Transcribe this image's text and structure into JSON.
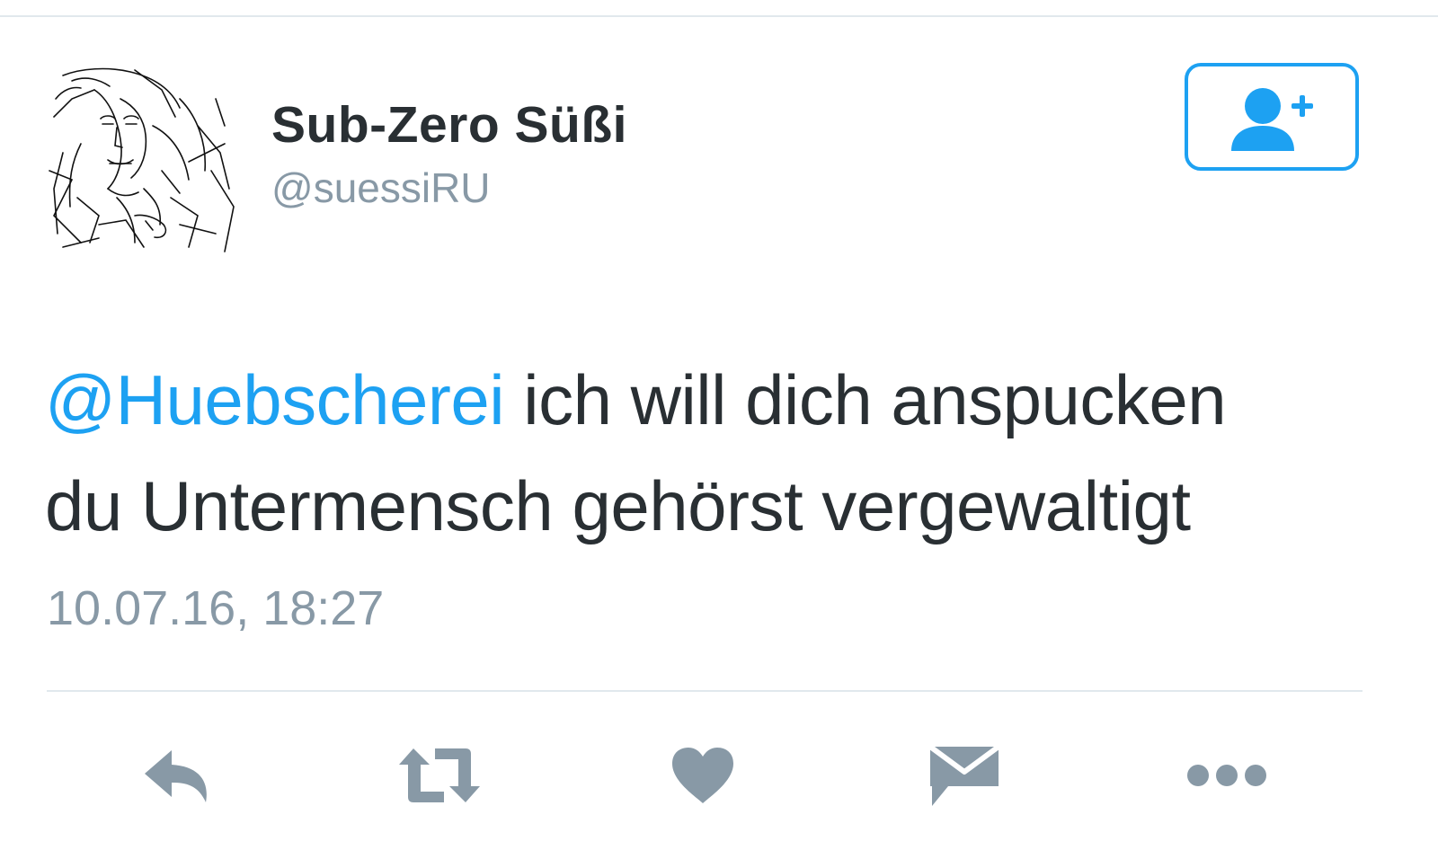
{
  "tweet": {
    "author": {
      "display_name": "Sub-Zero Süßi",
      "handle": "@suessiRU"
    },
    "text": {
      "mention": "@Huebscherei",
      "line1_rest": " ich will dich anspucken",
      "line2": "du Untermensch gehörst vergewaltigt"
    },
    "timestamp": "10.07.16, 18:27"
  },
  "follow_button": {
    "icon": "follow-user-plus-icon"
  },
  "actions": [
    {
      "name": "reply",
      "icon": "reply-icon"
    },
    {
      "name": "retweet",
      "icon": "retweet-icon"
    },
    {
      "name": "like",
      "icon": "heart-icon"
    },
    {
      "name": "direct-message",
      "icon": "envelope-icon"
    },
    {
      "name": "more",
      "icon": "more-dots-icon"
    }
  ],
  "colors": {
    "accent": "#1da1f2",
    "text": "#292f33",
    "muted": "#8899a6",
    "icon": "#8899a6",
    "divider": "#e1e8ed"
  }
}
